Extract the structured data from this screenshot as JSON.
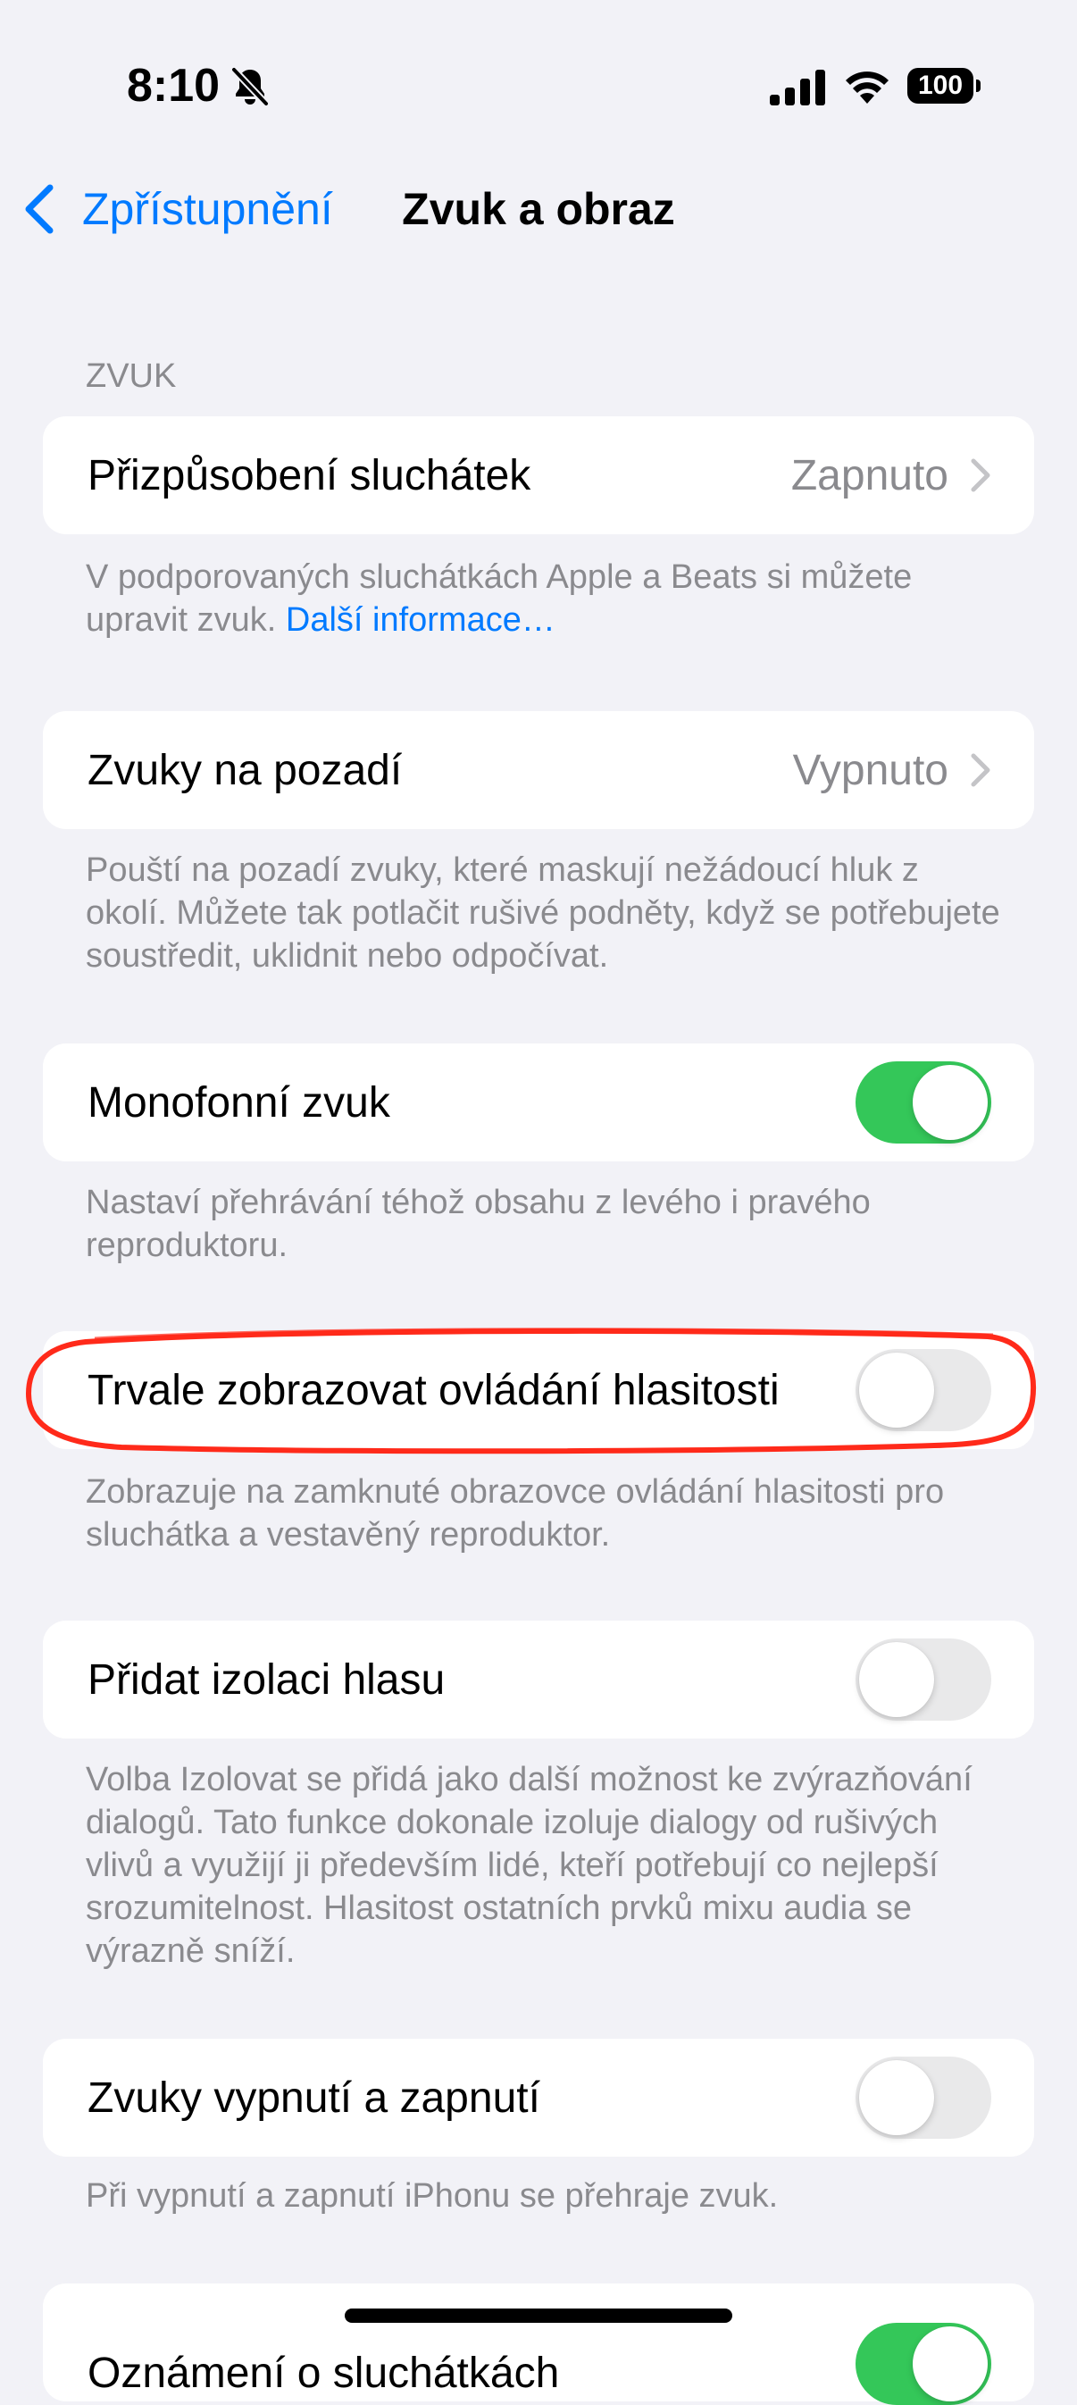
{
  "status_bar": {
    "time": "8:10",
    "battery": "100",
    "icons": [
      "bell-slash-icon",
      "cellular-signal-icon",
      "wifi-icon",
      "battery-icon"
    ]
  },
  "nav": {
    "back_label": "Zpřístupnění",
    "title": "Zvuk a obraz"
  },
  "section": {
    "header": "ZVUK"
  },
  "rows": {
    "headphone": {
      "label": "Přizpůsobení sluchátek",
      "value": "Zapnuto",
      "footer": "V podporovaných sluchátkách Apple a Beats si můžete upravit zvuk.",
      "footer_link": "Další informace…"
    },
    "background": {
      "label": "Zvuky na pozadí",
      "value": "Vypnuto",
      "footer": "Pouští na pozadí zvuky, které maskují nežádoucí hluk z okolí. Můžete tak potlačit rušivé podněty, když se potřebujete soustředit, uklidnit nebo odpočívat."
    },
    "mono": {
      "label": "Monofonní zvuk",
      "on": true,
      "footer": "Nastaví přehrávání téhož obsahu z levého i pravého reproduktoru."
    },
    "volume_control": {
      "label": "Trvale zobrazovat ovládání hlasitosti",
      "on": false,
      "footer": "Zobrazuje na zamknuté obrazovce ovládání hlasitosti pro sluchátka a vestavěný reproduktor."
    },
    "voice_isolation": {
      "label": "Přidat izolaci hlasu",
      "on": false,
      "footer": "Volba Izolovat se přidá jako další možnost ke zvýrazňování dialogů. Tato funkce dokonale izoluje dialogy od rušivých vlivů a využijí ji především lidé, kteří potřebují co nejlepší srozumitelnost. Hlasitost ostatních prvků mixu audia se výrazně sníží."
    },
    "power_sounds": {
      "label": "Zvuky vypnutí a zapnutí",
      "on": false,
      "footer": "Při vypnutí a zapnutí iPhonu se přehraje zvuk."
    },
    "headphone_notifications": {
      "label": "Oznámení o sluchátkách",
      "on": true
    }
  },
  "colors": {
    "accent": "#007aff",
    "toggle_on": "#34c759",
    "toggle_off": "#e9e9ea",
    "annotation": "#ff2a1a"
  }
}
